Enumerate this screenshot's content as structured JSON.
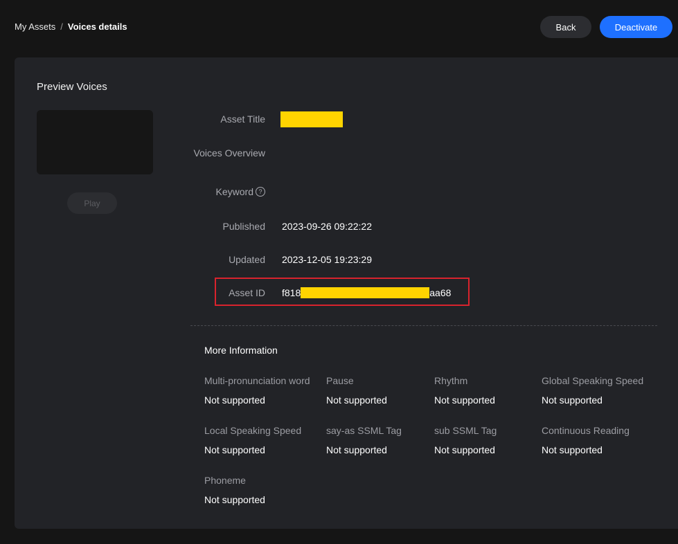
{
  "breadcrumb": {
    "root": "My Assets",
    "separator": "/",
    "current": "Voices details"
  },
  "actions": {
    "back_label": "Back",
    "deactivate_label": "Deactivate"
  },
  "preview": {
    "title": "Preview Voices",
    "play_label": "Play"
  },
  "details": {
    "asset_title_label": "Asset Title",
    "asset_title_value": "",
    "overview_label": "Voices Overview",
    "overview_value": "",
    "keyword_label": "Keyword",
    "keyword_value": "",
    "published_label": "Published",
    "published_value": "2023-09-26 09:22:22",
    "updated_label": "Updated",
    "updated_value": "2023-12-05 19:23:29",
    "asset_id_label": "Asset ID",
    "asset_id_prefix": "f818",
    "asset_id_suffix": "aa68"
  },
  "more_info": {
    "title": "More Information",
    "items": [
      {
        "label": "Multi-pronunciation word",
        "value": "Not supported"
      },
      {
        "label": "Pause",
        "value": "Not supported"
      },
      {
        "label": "Rhythm",
        "value": "Not supported"
      },
      {
        "label": "Global Speaking Speed",
        "value": "Not supported"
      },
      {
        "label": "Local Speaking Speed",
        "value": "Not supported"
      },
      {
        "label": "say-as SSML Tag",
        "value": "Not supported"
      },
      {
        "label": "sub SSML Tag",
        "value": "Not supported"
      },
      {
        "label": "Continuous Reading",
        "value": "Not supported"
      },
      {
        "label": "Phoneme",
        "value": "Not supported"
      }
    ]
  },
  "colors": {
    "accent": "#1e70ff",
    "highlight_frame": "#d9232d",
    "redaction": "#ffd400"
  },
  "icons": {
    "help": "question-circle-icon"
  }
}
